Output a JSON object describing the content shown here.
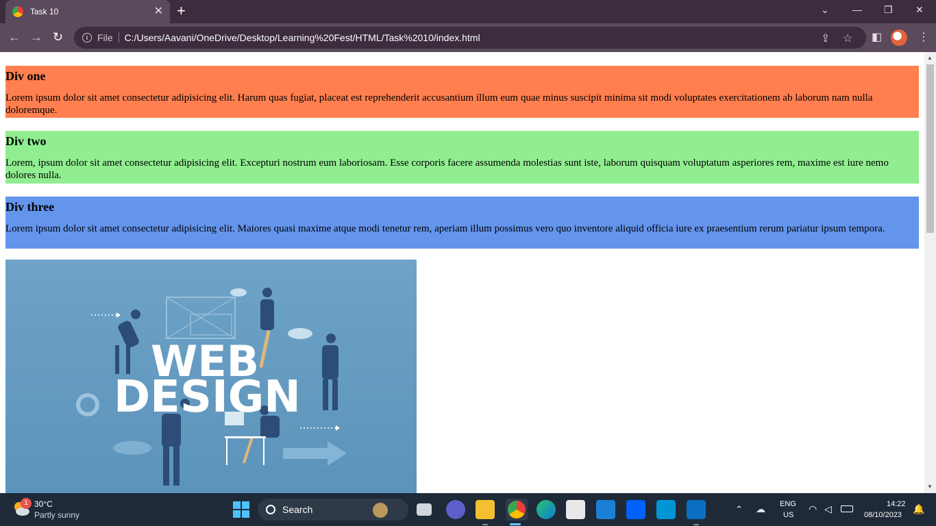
{
  "browser": {
    "tab_title": "Task 10",
    "url_scheme": "File",
    "url": "C:/Users/Aavani/OneDrive/Desktop/Learning%20Fest/HTML/Task%2010/index.html"
  },
  "page": {
    "sections": [
      {
        "heading": "Div one",
        "text": "Lorem ipsum dolor sit amet consectetur adipisicing elit. Harum quas fugiat, placeat est reprehenderit accusantium illum eum quae minus suscipit minima sit modi voluptates exercitationem ab laborum nam nulla doloremque.",
        "color": "#ff7f50"
      },
      {
        "heading": "Div two",
        "text": "Lorem, ipsum dolor sit amet consectetur adipisicing elit. Excepturi nostrum eum laboriosam. Esse corporis facere assumenda molestias sunt iste, laborum quisquam voluptatum asperiores rem, maxime est iure nemo dolores nulla.",
        "color": "#90ee90"
      },
      {
        "heading": "Div three",
        "text": "Lorem ipsum dolor sit amet consectetur adipisicing elit. Maiores quasi maxime atque modi tenetur rem, aperiam illum possimus vero quo inventore aliquid officia iure ex praesentium rerum pariatur ipsum tempora.",
        "color": "#6495ed"
      }
    ],
    "hero_image": {
      "line1": "WEB",
      "line2": "DESIGN"
    }
  },
  "taskbar": {
    "weather_badge": "1",
    "weather_temp": "30°C",
    "weather_desc": "Partly sunny",
    "search_label": "Search",
    "lang_primary": "ENG",
    "lang_secondary": "US",
    "time": "14:22",
    "date": "08/10/2023"
  },
  "colors": {
    "tabbar": "#3c2c3d",
    "toolbar": "#5a4a5c",
    "taskbar": "#1f2a38"
  }
}
